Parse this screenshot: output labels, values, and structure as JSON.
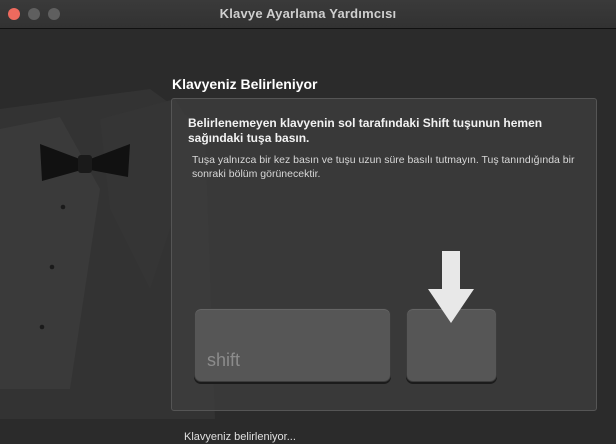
{
  "window": {
    "title": "Klavye Ayarlama Yardımcısı"
  },
  "main": {
    "heading": "Klavyeniz Belirleniyor",
    "instruction_bold": "Belirlenemeyen klavyenin sol tarafındaki Shift tuşunun hemen sağındaki tuşa basın.",
    "instruction": "Tuşa yalnızca bir kez basın ve tuşu uzun süre basılı tutmayın. Tuş tanındığında bir sonraki bölüm görünecektir.",
    "shift_key_label": "shift",
    "status": "Klavyeniz belirleniyor..."
  },
  "colors": {
    "close": "#ed6a5e",
    "inactive_button": "#5f5f5f"
  }
}
